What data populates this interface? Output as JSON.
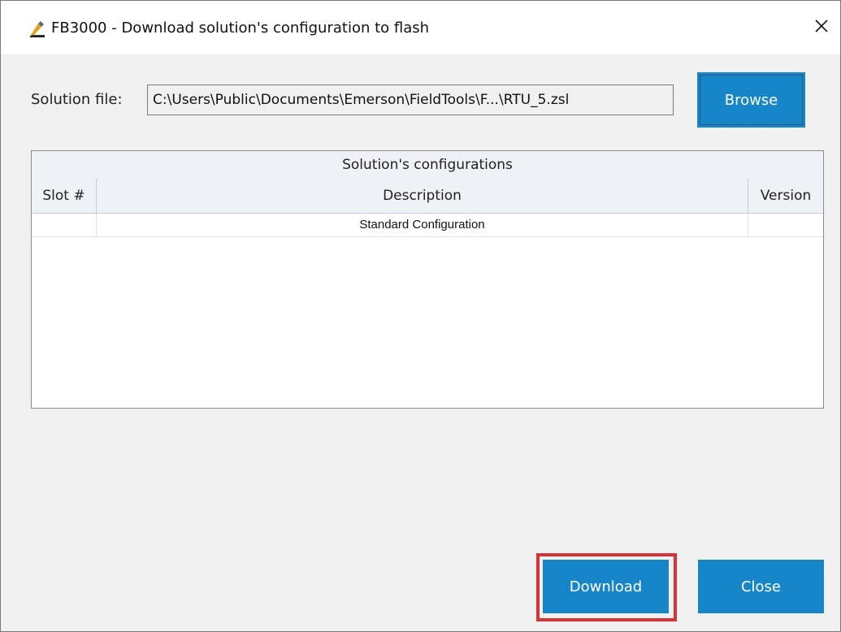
{
  "window": {
    "title": "FB3000 - Download solution's configuration to flash",
    "icon": "fieldtools-app-icon"
  },
  "solution": {
    "label": "Solution file:",
    "path": "C:\\Users\\Public\\Documents\\Emerson\\FieldTools\\F...\\RTU_5.zsl",
    "browse_label": "Browse"
  },
  "grid": {
    "group_title": "Solution's configurations",
    "columns": [
      "Slot #",
      "Description",
      "Version"
    ],
    "rows": [
      {
        "slot": "",
        "description": "Standard Configuration",
        "version": ""
      }
    ]
  },
  "buttons": {
    "download_label": "Download",
    "close_label": "Close"
  },
  "colors": {
    "accent": "#1686c8",
    "highlight": "#d9333a"
  }
}
